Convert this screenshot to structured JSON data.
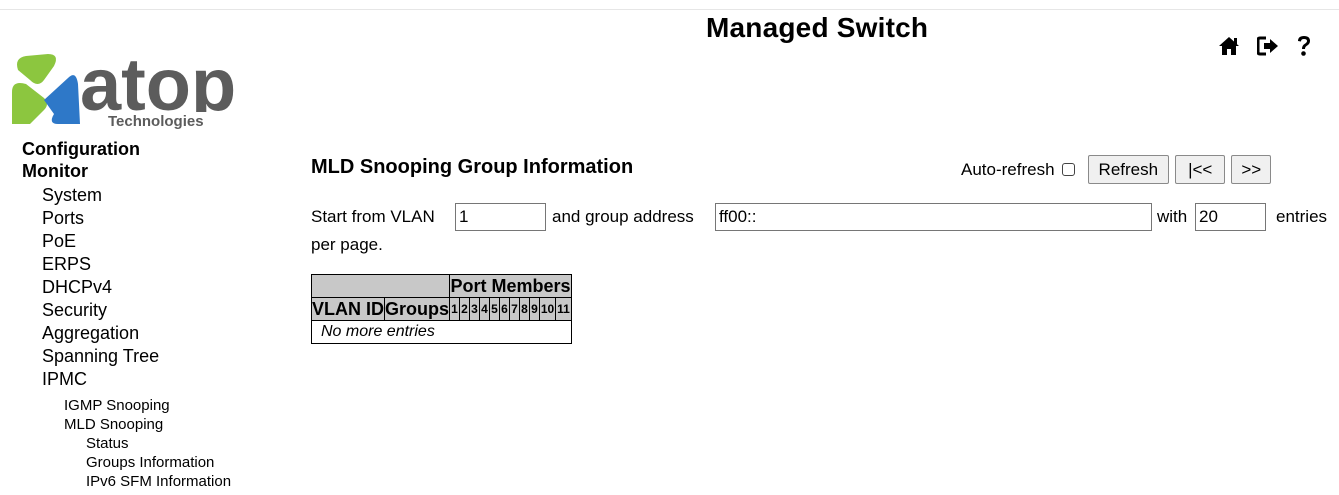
{
  "header": {
    "title": "Managed Switch",
    "logo": {
      "brand": "atop",
      "tagline": "Technologies"
    },
    "icons": [
      "home-icon",
      "logout-icon",
      "help-icon"
    ]
  },
  "sidebar": {
    "configuration": "Configuration",
    "monitor": "Monitor",
    "items": [
      "System",
      "Ports",
      "PoE",
      "ERPS",
      "DHCPv4",
      "Security",
      "Aggregation",
      "Spanning Tree",
      "IPMC"
    ],
    "ipmc_children": [
      "IGMP Snooping",
      "MLD Snooping"
    ],
    "mld_children": [
      "Status",
      "Groups Information",
      "IPv6 SFM Information"
    ]
  },
  "main": {
    "title": "MLD Snooping Group Information",
    "auto_refresh_label": "Auto-refresh",
    "auto_refresh_checked": false,
    "refresh_label": "Refresh",
    "first_label": "|<<",
    "next_label": ">>",
    "filter": {
      "start_label": "Start from VLAN",
      "vlan_value": "1",
      "group_label": "and group address",
      "group_value": "ff00::",
      "with_label": "with",
      "entries_value": "20",
      "entries_label": "entries",
      "per_page_label": "per page."
    },
    "table": {
      "port_members_header": "Port Members",
      "vlan_header": "VLAN ID",
      "groups_header": "Groups",
      "ports": [
        "1",
        "2",
        "3",
        "4",
        "5",
        "6",
        "7",
        "8",
        "9",
        "10",
        "11"
      ],
      "empty_message": "No more entries"
    }
  },
  "colors": {
    "logo_green": "#8cc63f",
    "logo_blue": "#2e78c8",
    "logo_gray": "#5c5c5c",
    "table_header": "#c8c8c8"
  }
}
